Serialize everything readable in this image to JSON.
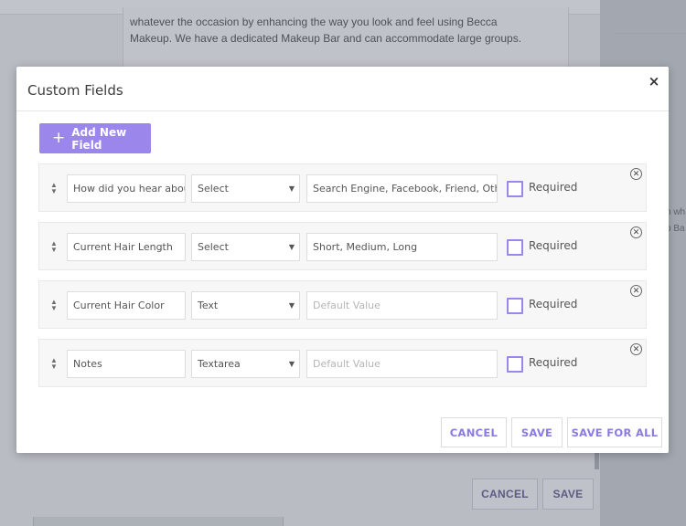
{
  "background": {
    "description_text": "whatever the occasion by enhancing the way you look and feel using Becca Makeup. We have a dedicated Makeup Bar and can accommodate large groups.",
    "right_text_line1": "n wh",
    "right_text_line2": "p Ba",
    "cancel_label": "CANCEL",
    "save_label": "SAVE"
  },
  "modal": {
    "title": "Custom Fields",
    "close_label": "×",
    "add_button_label": "Add New Field",
    "required_label": "Required",
    "fields": [
      {
        "name": "How did you hear about",
        "type": "Select",
        "options": "Search Engine, Facebook, Friend, Other",
        "options_is_placeholder": false,
        "required": false
      },
      {
        "name": "Current Hair Length",
        "type": "Select",
        "options": "Short, Medium, Long",
        "options_is_placeholder": false,
        "required": false
      },
      {
        "name": "Current Hair Color",
        "type": "Text",
        "options": "Default Value",
        "options_is_placeholder": true,
        "required": false
      },
      {
        "name": "Notes",
        "type": "Textarea",
        "options": "Default Value",
        "options_is_placeholder": true,
        "required": false
      }
    ],
    "footer": {
      "cancel_label": "CANCEL",
      "save_label": "SAVE",
      "save_all_label": "SAVE FOR ALL"
    }
  },
  "colors": {
    "accent": "#9b86ec",
    "accent_text": "#8b7ae3"
  }
}
